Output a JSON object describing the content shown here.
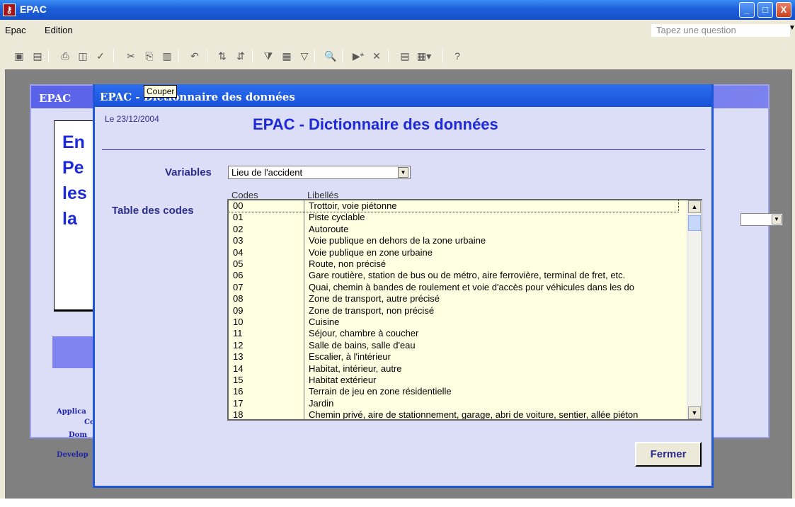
{
  "window": {
    "title": "EPAC",
    "minimize": "_",
    "restore": "□",
    "close": "X"
  },
  "menu": [
    "Epac",
    "Edition"
  ],
  "question": {
    "placeholder": "Tapez une question"
  },
  "toolbar": [
    "save-icon",
    "print-preview-icon",
    "print-icon",
    "preview-icon",
    "spellcheck-icon",
    "cut-icon",
    "copy-icon",
    "paste-icon",
    "undo-icon",
    "sort-asc-icon",
    "sort-desc-icon",
    "filter-icon",
    "filter-form-icon",
    "filter-toggle-icon",
    "find-icon",
    "goto-new-icon",
    "delete-record-icon",
    "database-window-icon",
    "new-object-icon",
    "help-icon"
  ],
  "background_window": {
    "title": "EPAC",
    "lines": [
      "En",
      "Pe",
      "les",
      "la "
    ],
    "footer": [
      "Applica",
      "Co",
      "Dom",
      "Develop"
    ]
  },
  "dialog": {
    "title": "EPAC - Dictionnaire des données",
    "tooltip": "Couper",
    "date": "Le 23/12/2004",
    "heading": "EPAC - Dictionnaire des données",
    "variables_label": "Variables",
    "variables_value": "Lieu de l'accident",
    "table_label": "Table des codes",
    "columns": {
      "code": "Codes",
      "label": "Libellés"
    },
    "rows": [
      {
        "code": "00",
        "label": "Trottoir, voie piétonne"
      },
      {
        "code": "01",
        "label": "Piste cyclable"
      },
      {
        "code": "02",
        "label": "Autoroute"
      },
      {
        "code": "03",
        "label": "Voie publique en dehors de la zone urbaine"
      },
      {
        "code": "04",
        "label": "Voie publique en zone urbaine"
      },
      {
        "code": "05",
        "label": "Route, non précisé"
      },
      {
        "code": "06",
        "label": "Gare routière, station de bus ou de métro, aire ferrovière, terminal de fret, etc."
      },
      {
        "code": "07",
        "label": "Quai, chemin à bandes de roulement et voie d'accès pour véhicules dans les do"
      },
      {
        "code": "08",
        "label": "Zone de transport, autre précisé"
      },
      {
        "code": "09",
        "label": "Zone de transport, non précisé"
      },
      {
        "code": "10",
        "label": "Cuisine"
      },
      {
        "code": "11",
        "label": "Séjour, chambre à coucher"
      },
      {
        "code": "12",
        "label": "Salle de bains, salle d'eau"
      },
      {
        "code": "13",
        "label": "Escalier, à l'intérieur"
      },
      {
        "code": "14",
        "label": "Habitat, intérieur, autre"
      },
      {
        "code": "15",
        "label": "Habitat extérieur"
      },
      {
        "code": "16",
        "label": "Terrain de jeu en zone résidentielle"
      },
      {
        "code": "17",
        "label": "Jardin"
      },
      {
        "code": "18",
        "label": "Chemin privé, aire de stationnement, garage, abri de voiture, sentier, allée piéton"
      }
    ],
    "close_button": "Fermer"
  }
}
